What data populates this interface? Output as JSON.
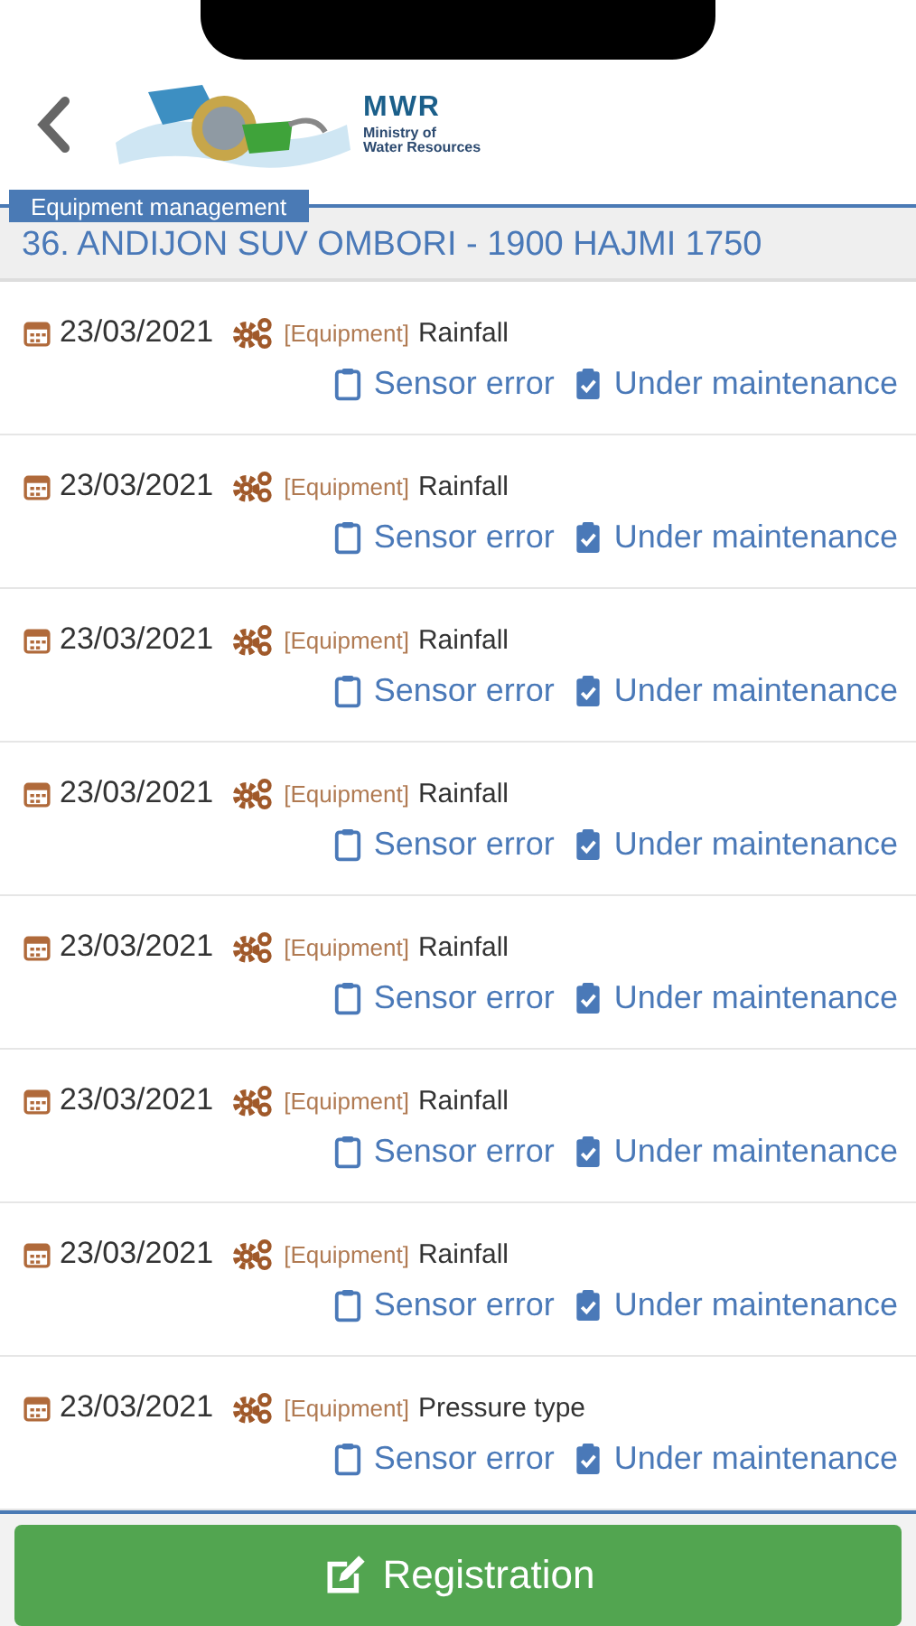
{
  "header": {
    "logo_title": "MWR",
    "logo_subtitle_1": "Ministry of",
    "logo_subtitle_2": "Water Resources"
  },
  "section_tab": "Equipment management",
  "title": "36. ANDIJON SUV OMBORI - 1900 HAJMI 1750",
  "records": [
    {
      "date": "23/03/2021",
      "category": "[Equipment]",
      "name": "Rainfall",
      "status_1": "Sensor error",
      "status_2": "Under maintenance"
    },
    {
      "date": "23/03/2021",
      "category": "[Equipment]",
      "name": "Rainfall",
      "status_1": "Sensor error",
      "status_2": "Under maintenance"
    },
    {
      "date": "23/03/2021",
      "category": "[Equipment]",
      "name": "Rainfall",
      "status_1": "Sensor error",
      "status_2": "Under maintenance"
    },
    {
      "date": "23/03/2021",
      "category": "[Equipment]",
      "name": "Rainfall",
      "status_1": "Sensor error",
      "status_2": "Under maintenance"
    },
    {
      "date": "23/03/2021",
      "category": "[Equipment]",
      "name": "Rainfall",
      "status_1": "Sensor error",
      "status_2": "Under maintenance"
    },
    {
      "date": "23/03/2021",
      "category": "[Equipment]",
      "name": "Rainfall",
      "status_1": "Sensor error",
      "status_2": "Under maintenance"
    },
    {
      "date": "23/03/2021",
      "category": "[Equipment]",
      "name": "Rainfall",
      "status_1": "Sensor error",
      "status_2": "Under maintenance"
    },
    {
      "date": "23/03/2021",
      "category": "[Equipment]",
      "name": "Pressure type",
      "status_1": "Sensor error",
      "status_2": "Under maintenance"
    }
  ],
  "action_button": "Registration"
}
